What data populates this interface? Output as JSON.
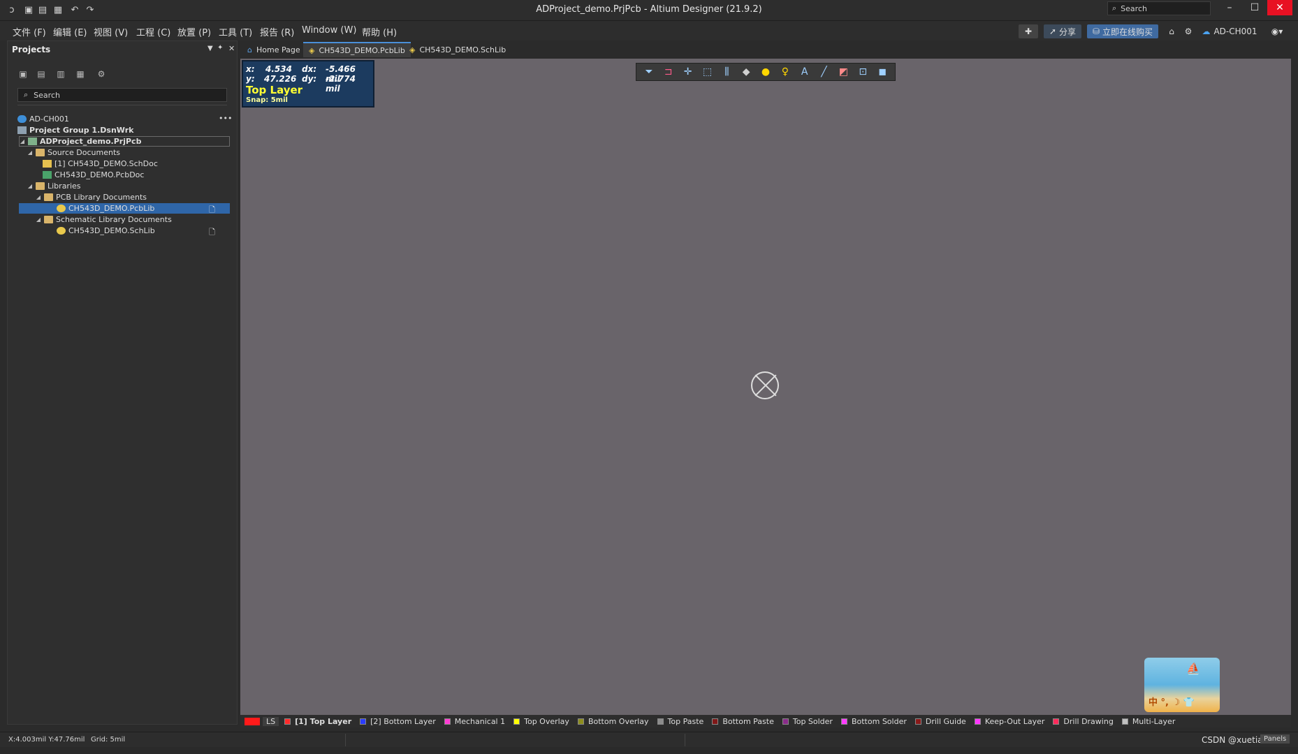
{
  "window": {
    "title": "ADProject_demo.PrjPcb - Altium Designer (21.9.2)",
    "search_placeholder": "Search",
    "minimize": "–",
    "maximize": "☐",
    "close": "✕"
  },
  "menu": {
    "items": [
      "文件 (F)",
      "编辑 (E)",
      "视图 (V)",
      "工程 (C)",
      "放置 (P)",
      "工具 (T)",
      "报告 (R)",
      "Window (W)",
      "帮助 (H)"
    ],
    "share_label": "分享",
    "buy_label": "立即在线购买",
    "account_label": "AD-CH001"
  },
  "panel": {
    "title": "Projects",
    "search_placeholder": "Search",
    "tree": [
      {
        "label": "AD-CH001",
        "icon": "cloud-icon"
      },
      {
        "label": "Project Group 1.DsnWrk",
        "icon": "project-group-icon"
      },
      {
        "label": "ADProject_demo.PrjPcb",
        "icon": "pcb-project-icon"
      },
      {
        "label": "Source Documents",
        "icon": "folder-icon"
      },
      {
        "label": "[1] CH543D_DEMO.SchDoc",
        "icon": "schematic-doc-icon"
      },
      {
        "label": "CH543D_DEMO.PcbDoc",
        "icon": "pcb-doc-icon"
      },
      {
        "label": "Libraries",
        "icon": "folder-icon"
      },
      {
        "label": "PCB Library Documents",
        "icon": "folder-icon"
      },
      {
        "label": "CH543D_DEMO.PcbLib",
        "icon": "pcb-library-icon"
      },
      {
        "label": "Schematic Library Documents",
        "icon": "folder-icon"
      },
      {
        "label": "CH543D_DEMO.SchLib",
        "icon": "schematic-library-icon"
      }
    ]
  },
  "tabs": [
    {
      "label": "Home Page",
      "icon": "home-icon"
    },
    {
      "label": "CH543D_DEMO.PcbLib",
      "icon": "pcb-library-icon"
    },
    {
      "label": "CH543D_DEMO.SchLib",
      "icon": "schematic-library-icon"
    }
  ],
  "hud": {
    "x_label": "x:",
    "x_value": "4.534",
    "dx_label": "dx:",
    "dx_value": "-5.466 mil",
    "y_label": "y:",
    "y_value": "47.226",
    "dy_label": "dy:",
    "dy_value": "-2.774 mil",
    "layer": "Top Layer",
    "snap": "Snap: 5mil"
  },
  "layers": {
    "ls_label": "LS",
    "items": [
      {
        "label": "[1] Top Layer",
        "color": "#ff2a2a"
      },
      {
        "label": "[2] Bottom Layer",
        "color": "#2a3cff"
      },
      {
        "label": "Mechanical 1",
        "color": "#ff3cd4"
      },
      {
        "label": "Top Overlay",
        "color": "#ffff00"
      },
      {
        "label": "Bottom Overlay",
        "color": "#8e8e1e"
      },
      {
        "label": "Top Paste",
        "color": "#8c8c8c"
      },
      {
        "label": "Bottom Paste",
        "color": "#801818"
      },
      {
        "label": "Top Solder",
        "color": "#8a2c8a"
      },
      {
        "label": "Bottom Solder",
        "color": "#ff3cff"
      },
      {
        "label": "Drill Guide",
        "color": "#8a1a1a"
      },
      {
        "label": "Keep-Out Layer",
        "color": "#ff36ff"
      },
      {
        "label": "Drill Drawing",
        "color": "#ff2a5a"
      },
      {
        "label": "Multi-Layer",
        "color": "#c0c0c0"
      }
    ]
  },
  "status": {
    "coords": "X:4.003mil Y:47.76mil",
    "grid": "Grid: 5mil",
    "watermark": "CSDN @xuetian39",
    "panels": "Panels"
  },
  "overlay": {
    "beach_label": "中 °, ☽ 👕"
  }
}
